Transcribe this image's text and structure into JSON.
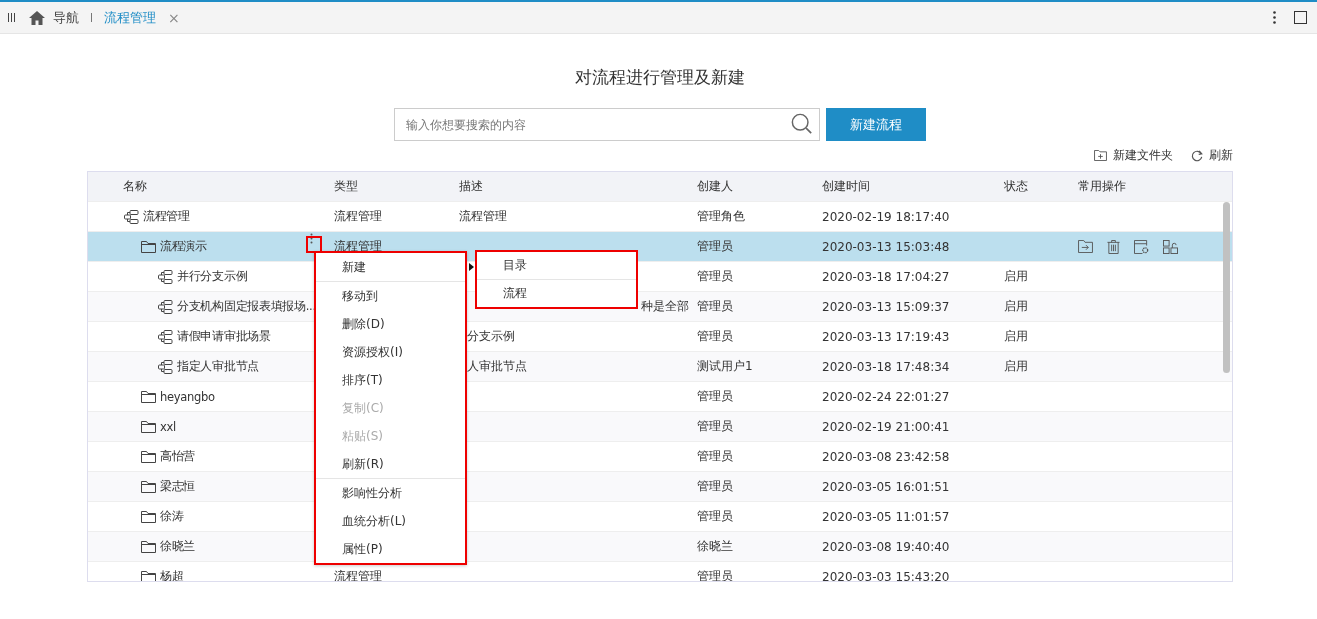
{
  "tabs": [
    {
      "label": "导航",
      "kind": "home",
      "selected": false
    },
    {
      "label": "流程管理",
      "kind": "page",
      "selected": true,
      "close": "×"
    }
  ],
  "heading": "对流程进行管理及新建",
  "search": {
    "placeholder": "输入你想要搜索的内容"
  },
  "new_button": "新建流程",
  "actions": [
    {
      "label": "新建文件夹",
      "kind": "folder"
    },
    {
      "label": "刷新",
      "kind": "refresh"
    }
  ],
  "table": {
    "columns": [
      "名称",
      "类型",
      "描述",
      "创建人",
      "创建时间",
      "状态",
      "常用操作"
    ],
    "rows": [
      {
        "name": "流程管理",
        "kind": "flow",
        "type": "流程管理",
        "description": "流程管理",
        "creator": "管理角色",
        "created": "2020-02-19 18:17:40",
        "selected": false,
        "children": [
          {
            "name": "流程演示",
            "kind": "folder",
            "type": "流程管理",
            "creator": "管理员",
            "created": "2020-03-13 15:03:48",
            "selected": true,
            "children": [
              {
                "name": "并行分支示例",
                "kind": "flow",
                "creator": "管理员",
                "created": "2020-03-18 17:04:27",
                "status": "启用",
                "selected": false
              },
              {
                "name": "分支机构固定报表填报场...",
                "kind": "flow",
                "description": "种是全部",
                "creator": "管理员",
                "created": "2020-03-13 15:09:37",
                "status": "启用",
                "selected": false
              },
              {
                "name": "请假申请审批场景",
                "kind": "flow",
                "description": "分支示例",
                "creator": "管理员",
                "created": "2020-03-13 17:19:43",
                "status": "启用",
                "selected": false
              },
              {
                "name": "指定人审批节点",
                "kind": "flow",
                "description": "人审批节点",
                "creator": "测试用户1",
                "created": "2020-03-18 17:48:34",
                "status": "启用",
                "selected": false
              }
            ]
          },
          {
            "name": "heyangbo",
            "kind": "folder",
            "creator": "管理员",
            "created": "2020-02-24 22:01:27",
            "selected": false
          },
          {
            "name": "xxl",
            "kind": "folder",
            "creator": "管理员",
            "created": "2020-02-19 21:00:41",
            "selected": false
          },
          {
            "name": "高怡营",
            "kind": "folder",
            "creator": "管理员",
            "created": "2020-03-08 23:42:58",
            "selected": false
          },
          {
            "name": "梁志恒",
            "kind": "folder",
            "creator": "管理员",
            "created": "2020-03-05 16:01:51",
            "selected": false
          },
          {
            "name": "徐涛",
            "kind": "folder",
            "creator": "管理员",
            "created": "2020-03-05 11:01:57",
            "selected": false
          },
          {
            "name": "徐晓兰",
            "kind": "folder",
            "creator": "徐晓兰",
            "created": "2020-03-08 19:40:40",
            "selected": false
          },
          {
            "name": "杨超",
            "kind": "folder",
            "type": "流程管理",
            "creator": "管理员",
            "created": "2020-03-03 15:43:20",
            "selected": false
          }
        ]
      }
    ]
  },
  "context_menu": {
    "groups": [
      [
        {
          "label": "新建",
          "disabled": false,
          "submenu": [
            {
              "label": "目录"
            },
            {
              "label": "流程"
            }
          ]
        }
      ],
      [
        {
          "label": "移动到",
          "disabled": false
        },
        {
          "label": "删除(D)",
          "disabled": false
        },
        {
          "label": "资源授权(I)",
          "disabled": false
        },
        {
          "label": "排序(T)",
          "disabled": false
        },
        {
          "label": "复制(C)",
          "disabled": true
        },
        {
          "label": "粘贴(S)",
          "disabled": true
        },
        {
          "label": "刷新(R)",
          "disabled": false
        }
      ],
      [
        {
          "label": "影响性分析",
          "disabled": false
        },
        {
          "label": "血统分析(L)",
          "disabled": false
        },
        {
          "label": "属性(P)",
          "disabled": false
        }
      ]
    ]
  }
}
